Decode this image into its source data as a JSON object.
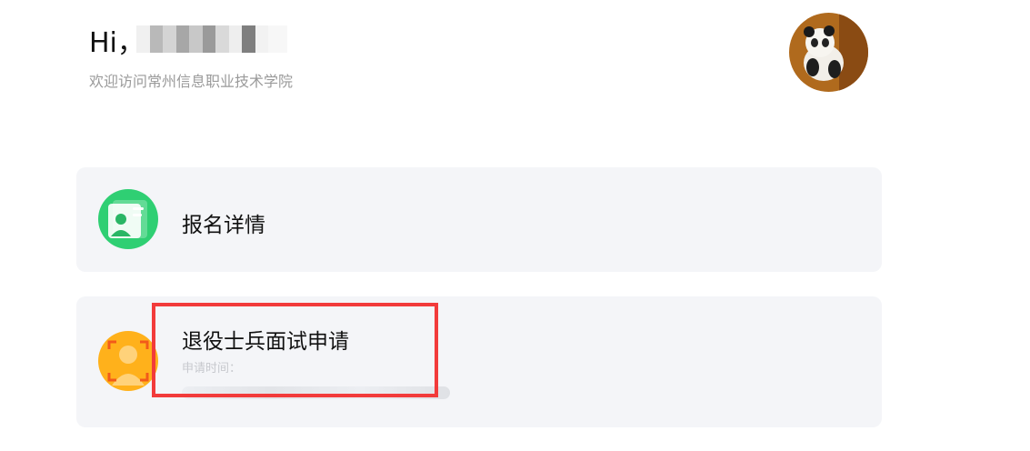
{
  "header": {
    "greeting": "Hi，",
    "subtitle": "欢迎访问常州信息职业技术学院"
  },
  "cards": [
    {
      "title": "报名详情",
      "icon": "id-card-icon"
    },
    {
      "title": "退役士兵面试申请",
      "meta_label": "申请时间：",
      "icon": "face-scan-icon"
    }
  ],
  "colors": {
    "green": "#2fcf73",
    "orange": "#ffb11b",
    "card_bg": "#f4f5f8",
    "highlight": "#f23b3b"
  }
}
